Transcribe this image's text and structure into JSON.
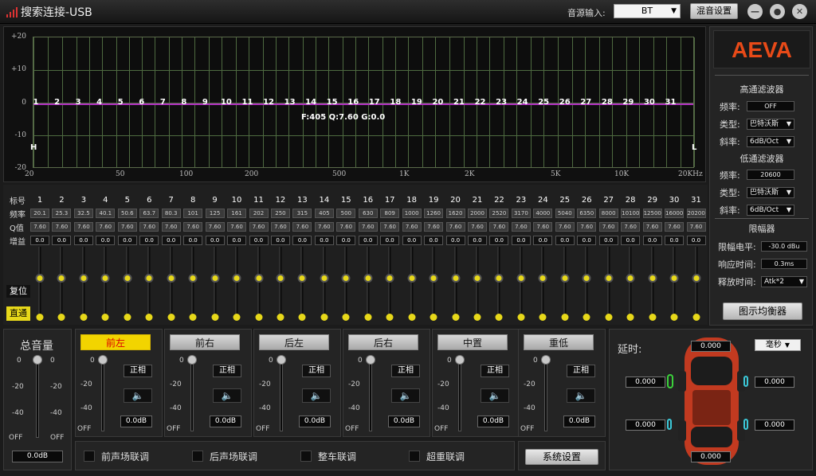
{
  "window": {
    "title": "搜索连接-USB",
    "source_label": "音源输入:",
    "source_value": "BT",
    "mix_button": "混音设置",
    "minimize": "—",
    "restore": "●",
    "close": "✕"
  },
  "graph": {
    "y_labels": [
      "+20",
      "+10",
      "0",
      "-10",
      "-20"
    ],
    "x_labels": [
      "20",
      "50",
      "100",
      "200",
      "500",
      "1K",
      "2K",
      "5K",
      "10K",
      "20KHz"
    ],
    "info": "F:405 Q:7.60 G:0.0",
    "h_marker": "H",
    "l_marker": "L"
  },
  "bands": {
    "row_labels": [
      "标号",
      "频率",
      "Q值",
      "增益"
    ],
    "numbers": [
      "1",
      "2",
      "3",
      "4",
      "5",
      "6",
      "7",
      "8",
      "9",
      "10",
      "11",
      "12",
      "13",
      "14",
      "15",
      "16",
      "17",
      "18",
      "19",
      "20",
      "21",
      "22",
      "23",
      "24",
      "25",
      "26",
      "27",
      "28",
      "29",
      "30",
      "31"
    ],
    "freqs": [
      "20.1",
      "25.3",
      "32.5",
      "40.1",
      "50.6",
      "63.7",
      "80.3",
      "101",
      "125",
      "161",
      "202",
      "250",
      "315",
      "405",
      "500",
      "630",
      "809",
      "1000",
      "1260",
      "1620",
      "2000",
      "2520",
      "3170",
      "4000",
      "5040",
      "6350",
      "8000",
      "10100",
      "12500",
      "16000",
      "20200"
    ],
    "q": "7.60",
    "gain": "0.0",
    "reset": "复位",
    "pass": "直通"
  },
  "filters": {
    "logo": "AEVA",
    "hp_title": "高通滤波器",
    "freq_label": "频率:",
    "type_label": "类型:",
    "slope_label": "斜率:",
    "hp_freq": "OFF",
    "hp_type": "巴特沃斯",
    "hp_slope": "6dB/Oct",
    "lp_title": "低通滤波器",
    "lp_freq": "20600",
    "lp_type": "巴特沃斯",
    "lp_slope": "6dB/Oct",
    "lim_title": "限幅器",
    "lim_level_label": "限幅电平:",
    "lim_level": "-30.0 dBu",
    "attack_label": "响应时间:",
    "attack": "0.3ms",
    "release_label": "释放时间:",
    "release": "Atk*2",
    "geq_button": "图示均衡器"
  },
  "master": {
    "title": "总音量",
    "scale": [
      "0",
      "-20",
      "-40",
      "OFF"
    ],
    "value": "0.0dB"
  },
  "channels": [
    {
      "name": "前左",
      "phase": "正相",
      "db": "0.0dB"
    },
    {
      "name": "前右",
      "phase": "正相",
      "db": "0.0dB"
    },
    {
      "name": "后左",
      "phase": "正相",
      "db": "0.0dB"
    },
    {
      "name": "后右",
      "phase": "正相",
      "db": "0.0dB"
    },
    {
      "name": "中置",
      "phase": "正相",
      "db": "0.0dB"
    },
    {
      "name": "重低",
      "phase": "正相",
      "db": "0.0dB"
    }
  ],
  "channel_scale": [
    "0",
    "-20",
    "-40",
    "OFF"
  ],
  "links": [
    "前声场联调",
    "后声场联调",
    "整车联调",
    "超重联调"
  ],
  "system_button": "系统设置",
  "delay": {
    "label": "延时:",
    "unit": "毫秒",
    "center": "0.000",
    "front_left": "0.000",
    "front_right": "0.000",
    "rear_left": "0.000",
    "rear_right": "0.000",
    "sub": "0.000"
  },
  "colors": {
    "accent": "#f2d400",
    "curve": "#b030c0",
    "logo": "#e84a18",
    "grid": "#4e6a40"
  }
}
